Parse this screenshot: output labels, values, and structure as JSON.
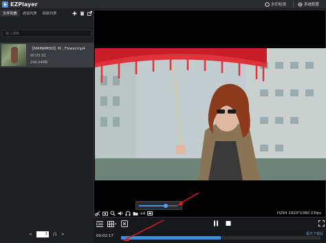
{
  "app": {
    "title": "EZPlayer"
  },
  "titlebar": {
    "watermark_check": "水印检测",
    "system_settings": "系统配置"
  },
  "tabs": [
    {
      "label": "文件列表",
      "active": true
    },
    {
      "label": "通道列表",
      "active": false
    },
    {
      "label": "网络列表",
      "active": false
    }
  ],
  "search": {
    "placeholder": "输入搜索"
  },
  "files": [
    {
      "name": "【MAMAMOO】M...Flowecmp4",
      "duration": "00:05:32",
      "size": "248.94MB"
    }
  ],
  "pager": {
    "current": "1",
    "total": "/1"
  },
  "player": {
    "info": "H264 1920*1080 23fps",
    "speed": "x4",
    "volume_level": 0.7,
    "current_time": "00:02:17",
    "progress": 0.5
  },
  "colors": {
    "accent": "#3f8de0",
    "annotation": "#e02020"
  },
  "watermark": "极光下载站"
}
